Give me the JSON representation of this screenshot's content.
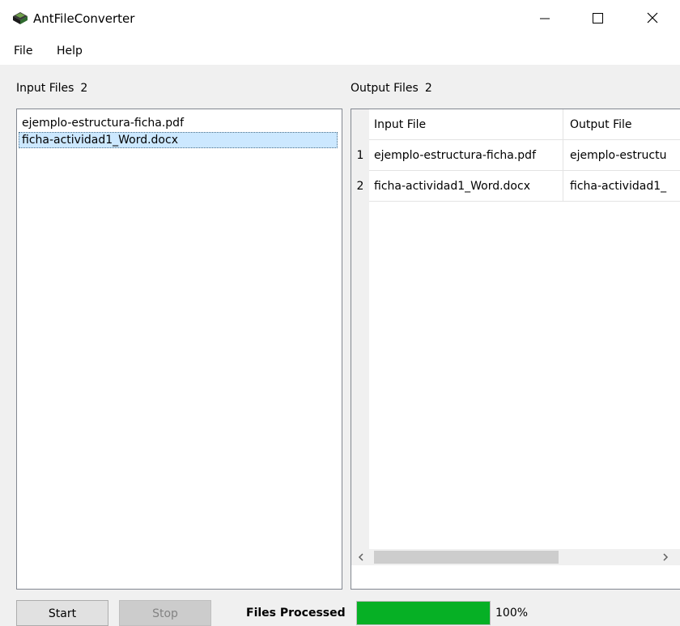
{
  "window": {
    "title": "AntFileConverter",
    "minimize_glyph": "—",
    "maximize_glyph": "☐",
    "close_glyph": "✕"
  },
  "icons": {
    "app": "ant-app-icon",
    "minimize": "minimize-icon",
    "maximize": "maximize-icon",
    "close": "close-icon",
    "scroll_left": "chevron-left-icon",
    "scroll_right": "chevron-right-icon"
  },
  "menu": {
    "file": "File",
    "help": "Help"
  },
  "input_panel": {
    "label": "Input Files",
    "count": "2",
    "files": [
      {
        "name": "ejemplo-estructura-ficha.pdf",
        "selected": false
      },
      {
        "name": "ficha-actividad1_Word.docx",
        "selected": true
      }
    ]
  },
  "output_panel": {
    "label": "Output Files",
    "count": "2",
    "columns": [
      "Input File",
      "Output File"
    ],
    "rows": [
      {
        "index": "1",
        "input": "ejemplo-estructura-ficha.pdf",
        "output": "ejemplo-estructu"
      },
      {
        "index": "2",
        "input": "ficha-actividad1_Word.docx",
        "output": "ficha-actividad1_"
      }
    ]
  },
  "controls": {
    "start_label": "Start",
    "stop_label": "Stop",
    "progress_label": "Files Processed",
    "progress_percent": 100,
    "progress_text": "100%"
  },
  "colors": {
    "progress_fill": "#06b025",
    "selection": "#cce8ff",
    "window_bg": "#f0f0f0"
  }
}
